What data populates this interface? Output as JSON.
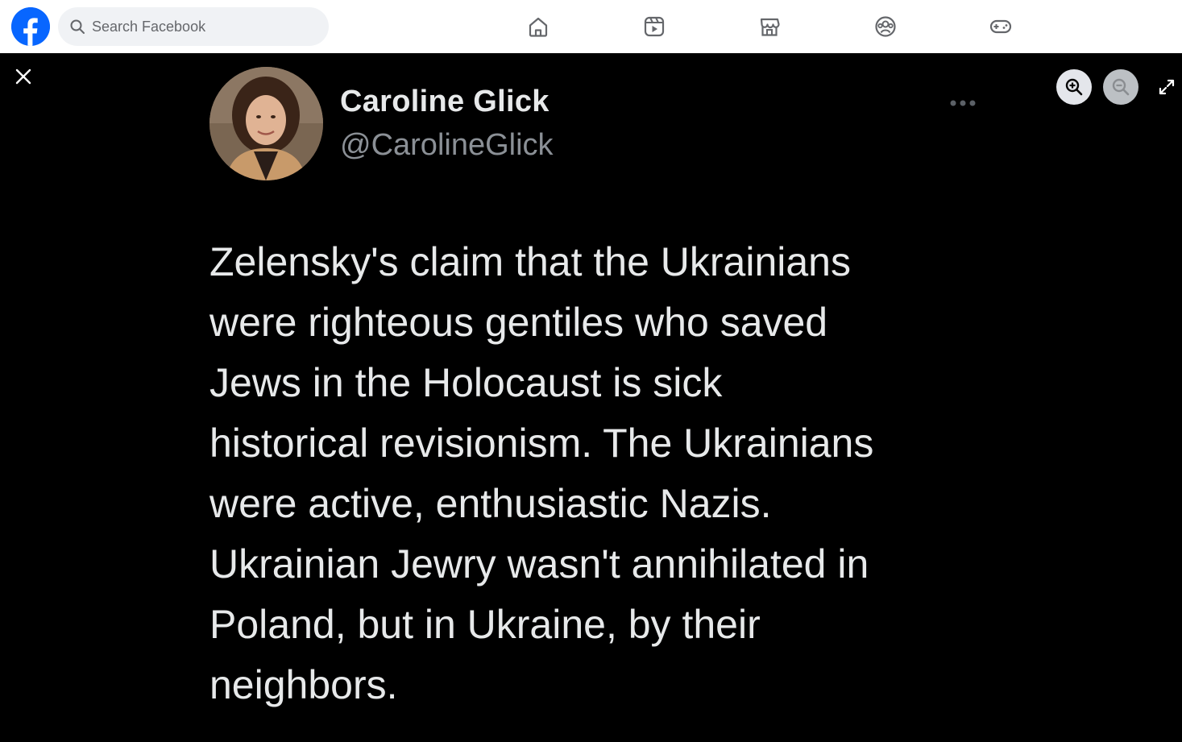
{
  "header": {
    "search": {
      "placeholder": "Search Facebook",
      "value": ""
    },
    "nav_icons": [
      "home-icon",
      "video-icon",
      "marketplace-icon",
      "groups-icon",
      "gaming-icon"
    ],
    "brand_color": "#0866ff"
  },
  "viewer": {
    "background_color": "#000000"
  },
  "tweet": {
    "author_name": "Caroline Glick",
    "author_handle": "@CarolineGlick",
    "text": "Zelensky's claim that the Ukrainians\nwere righteous gentiles who saved\nJews in the Holocaust is sick\nhistorical revisionism. The Ukrainians\nwere active, enthusiastic Nazis.\nUkrainian Jewry wasn't annihilated in\nPoland, but in Ukraine, by their\nneighbors."
  }
}
